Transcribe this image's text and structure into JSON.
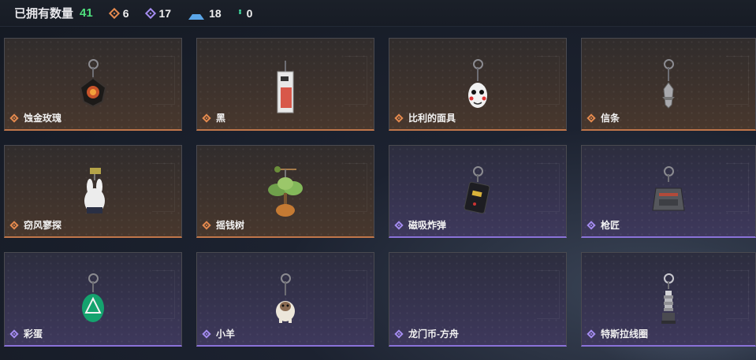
{
  "header": {
    "owned_label": "已拥有数量",
    "owned_count": "41",
    "stats": [
      {
        "icon": "orange-diamond-icon",
        "value": "6",
        "color": "#e58a4e"
      },
      {
        "icon": "purple-diamond-icon",
        "value": "17",
        "color": "#a48cf0"
      },
      {
        "icon": "blue-chevron-icon",
        "value": "18",
        "color": "#5aa6e8"
      },
      {
        "icon": "green-dots-icon",
        "value": "0",
        "color": "#3fd39a"
      }
    ]
  },
  "items": [
    {
      "name": "蚀金玫瑰",
      "tier": "orange",
      "icon": "rose-charm-icon"
    },
    {
      "name": "黑",
      "tier": "orange",
      "icon": "card-charm-icon"
    },
    {
      "name": "比利的面具",
      "tier": "orange",
      "icon": "mask-charm-icon"
    },
    {
      "name": "信条",
      "tier": "orange",
      "icon": "blade-charm-icon"
    },
    {
      "name": "窃风寥探",
      "tier": "orange",
      "icon": "rabbit-charm-icon"
    },
    {
      "name": "摇钱树",
      "tier": "orange",
      "icon": "money-tree-charm-icon"
    },
    {
      "name": "磁吸炸弹",
      "tier": "purple",
      "icon": "bomb-charm-icon"
    },
    {
      "name": "枪匠",
      "tier": "purple",
      "icon": "gunsmith-charm-icon"
    },
    {
      "name": "彩蛋",
      "tier": "purple",
      "icon": "easter-egg-charm-icon"
    },
    {
      "name": "小羊",
      "tier": "purple",
      "icon": "lamb-charm-icon"
    },
    {
      "name": "龙门币-方舟",
      "tier": "purple",
      "icon": "coin-charm-icon"
    },
    {
      "name": "特斯拉线圈",
      "tier": "purple",
      "icon": "tesla-coil-charm-icon"
    }
  ]
}
